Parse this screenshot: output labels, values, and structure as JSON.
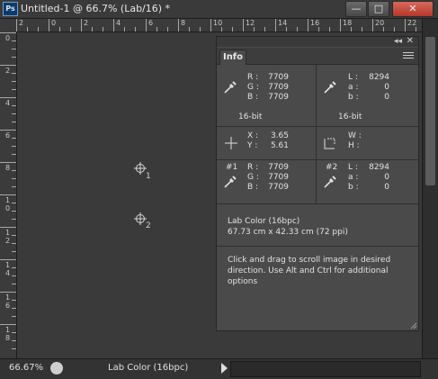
{
  "app": {
    "logo_text": "Ps"
  },
  "window": {
    "title": "Untitled-1 @ 66.7% (Lab/16) *"
  },
  "window_controls": {
    "minimize": "—",
    "maximize": "□",
    "close": "✕"
  },
  "ruler_h_labels": [
    "2",
    "0",
    "2",
    "4",
    "6",
    "8",
    "10",
    "12",
    "14",
    "16",
    "18",
    "20",
    "22"
  ],
  "ruler_v_labels": [
    "0",
    "2",
    "4",
    "6",
    "8",
    "1\n0",
    "1\n2",
    "1\n4",
    "1\n6",
    "1\n8"
  ],
  "canvas": {
    "sampler1": "1",
    "sampler2": "2"
  },
  "panel": {
    "tab": "Info",
    "collapse": "◂◂",
    "close": "✕",
    "rgb": {
      "r_label": "R :",
      "g_label": "G :",
      "b_label": "B :",
      "r": "7709",
      "g": "7709",
      "b": "7709",
      "bit": "16-bit"
    },
    "lab": {
      "l_label": "L :",
      "a_label": "a :",
      "b_label": "b :",
      "l": "8294",
      "a": "0",
      "b": "0",
      "bit": "16-bit"
    },
    "coords": {
      "x_label": "X :",
      "y_label": "Y :",
      "x": "3.65",
      "y": "5.61",
      "w_label": "W :",
      "h_label": "H :"
    },
    "sampler1": {
      "id": "#1",
      "r_label": "R :",
      "g_label": "G :",
      "b_label": "B :",
      "r": "7709",
      "g": "7709",
      "b": "7709"
    },
    "sampler2": {
      "id": "#2",
      "l_label": "L :",
      "a_label": "a :",
      "b_label": "b :",
      "l": "8294",
      "a": "0",
      "b": "0"
    },
    "doc_info": {
      "mode": "Lab Color (16bpc)",
      "size": "67.73 cm x 42.33 cm (72 ppi)"
    },
    "hint": "Click and drag to scroll image in desired direction.  Use Alt and Ctrl for additional options"
  },
  "status": {
    "zoom": "66.67%",
    "doc": "Lab Color (16bpc)"
  },
  "colors": {
    "canvas": "#3a3a3a",
    "panel": "#4a4a4a",
    "chrome": "#333333"
  }
}
